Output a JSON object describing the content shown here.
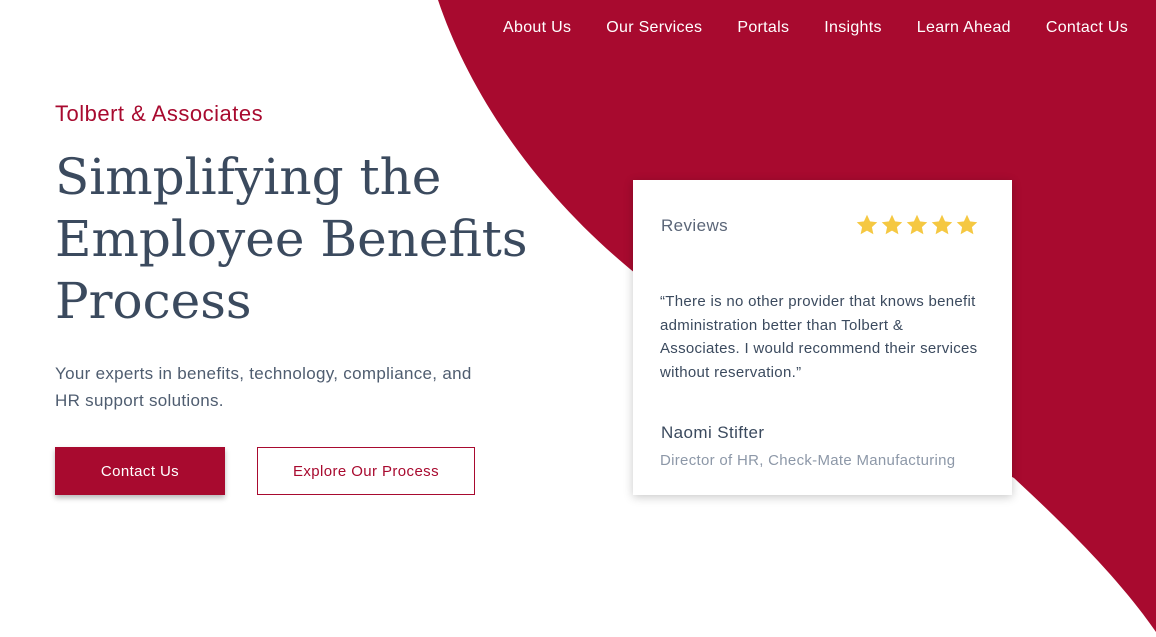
{
  "colors": {
    "brand": "#a80a2f",
    "heading": "#3b4a5e",
    "star": "#f5c842"
  },
  "nav": {
    "items": [
      {
        "label": "About Us"
      },
      {
        "label": "Our Services"
      },
      {
        "label": "Portals"
      },
      {
        "label": "Insights"
      },
      {
        "label": "Learn Ahead"
      },
      {
        "label": "Contact Us"
      }
    ]
  },
  "hero": {
    "brand": "Tolbert & Associates",
    "title": "Simplifying the Employee Benefits Process",
    "subtitle": "Your experts in benefits, technology, compliance, and HR support solutions.",
    "primary_button": "Contact Us",
    "secondary_button": "Explore Our Process"
  },
  "review": {
    "heading": "Reviews",
    "rating": 5,
    "rating_max": 5,
    "star_icon": "star-icon",
    "quote": "“There is no other provider that knows benefit administration better than Tolbert & Associates. I would recommend their services without reservation.”",
    "name": "Naomi Stifter",
    "title": "Director of HR, Check-Mate Manufacturing"
  }
}
